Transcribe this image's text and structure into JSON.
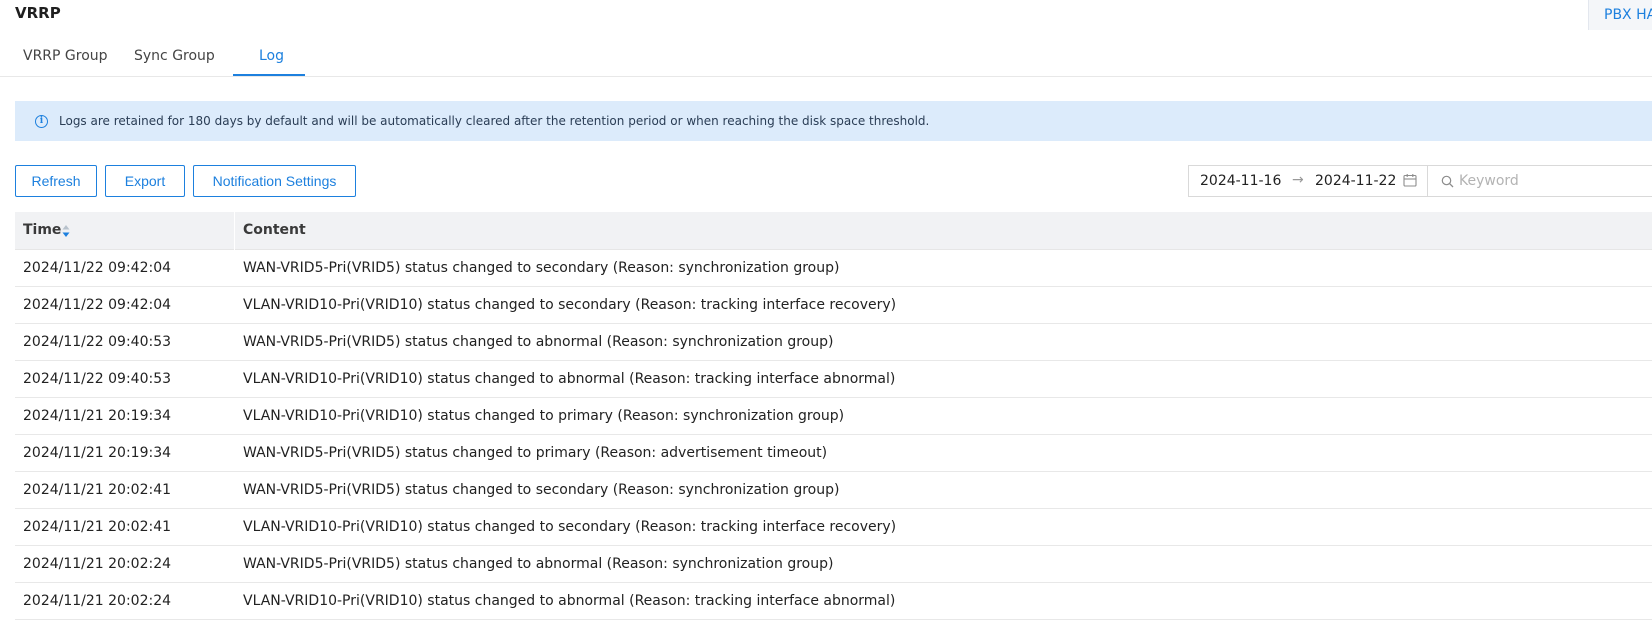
{
  "page": {
    "title": "VRRP",
    "corner_button": "PBX HA"
  },
  "tabs": [
    {
      "label": "VRRP Group",
      "active": false
    },
    {
      "label": "Sync Group",
      "active": false
    },
    {
      "label": "Log",
      "active": true
    }
  ],
  "notice": {
    "icon": "info-icon",
    "text": "Logs are retained for 180 days by default and will be automatically cleared after the retention period or when reaching the disk space threshold."
  },
  "toolbar": {
    "refresh_label": "Refresh",
    "export_label": "Export",
    "notification_label": "Notification Settings"
  },
  "filters": {
    "date_start": "2024-11-16",
    "date_separator": "→",
    "date_end": "2024-11-22",
    "search_placeholder": "Keyword",
    "search_value": ""
  },
  "table": {
    "columns": [
      "Time",
      "Content"
    ],
    "sorted_column": "Time",
    "rows": [
      {
        "time": "2024/11/22 09:42:04",
        "content": "WAN-VRID5-Pri(VRID5) status changed to secondary (Reason: synchronization group)"
      },
      {
        "time": "2024/11/22 09:42:04",
        "content": "VLAN-VRID10-Pri(VRID10) status changed to secondary (Reason: tracking interface recovery)"
      },
      {
        "time": "2024/11/22 09:40:53",
        "content": "WAN-VRID5-Pri(VRID5) status changed to abnormal (Reason: synchronization group)"
      },
      {
        "time": "2024/11/22 09:40:53",
        "content": "VLAN-VRID10-Pri(VRID10) status changed to abnormal (Reason: tracking interface abnormal)"
      },
      {
        "time": "2024/11/21 20:19:34",
        "content": "VLAN-VRID10-Pri(VRID10) status changed to primary (Reason: synchronization group)"
      },
      {
        "time": "2024/11/21 20:19:34",
        "content": "WAN-VRID5-Pri(VRID5) status changed to primary (Reason: advertisement timeout)"
      },
      {
        "time": "2024/11/21 20:02:41",
        "content": "WAN-VRID5-Pri(VRID5) status changed to secondary (Reason: synchronization group)"
      },
      {
        "time": "2024/11/21 20:02:41",
        "content": "VLAN-VRID10-Pri(VRID10) status changed to secondary (Reason: tracking interface recovery)"
      },
      {
        "time": "2024/11/21 20:02:24",
        "content": "WAN-VRID5-Pri(VRID5) status changed to abnormal (Reason: synchronization group)"
      },
      {
        "time": "2024/11/21 20:02:24",
        "content": "VLAN-VRID10-Pri(VRID10) status changed to abnormal (Reason: tracking interface abnormal)"
      }
    ]
  },
  "colors": {
    "accent": "#1d80de",
    "notice_bg": "#dcebfb",
    "table_header_bg": "#f1f2f4"
  }
}
